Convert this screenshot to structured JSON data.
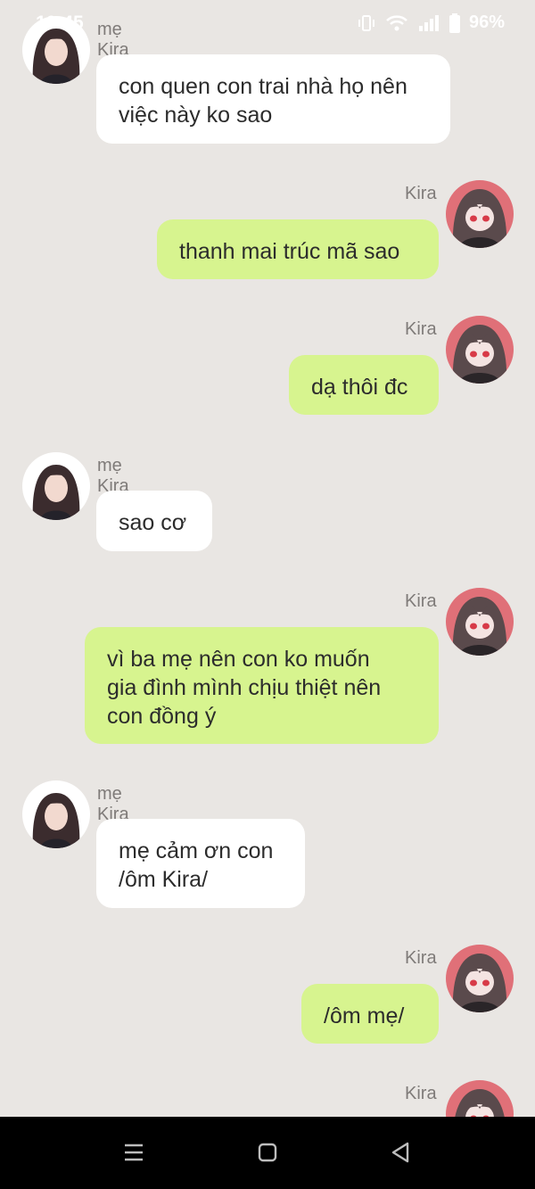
{
  "status": {
    "time": "10:45",
    "battery": "96%"
  },
  "messages": [
    {
      "side": "left",
      "sender": "mẹ Kira",
      "text": "con quen con trai nhà họ nên\nviệc này ko sao"
    },
    {
      "side": "right",
      "sender": "Kira",
      "text": "thanh mai trúc mã sao"
    },
    {
      "side": "right",
      "sender": "Kira",
      "text": "dạ thôi đc"
    },
    {
      "side": "left",
      "sender": "mẹ Kira",
      "text": "sao cơ"
    },
    {
      "side": "right",
      "sender": "Kira",
      "text": "vì ba mẹ nên con ko muốn\ngia đình mình chịu thiệt nên\ncon đồng ý"
    },
    {
      "side": "left",
      "sender": "mẹ Kira",
      "text": "mẹ cảm ơn con\n/ôm Kira/"
    },
    {
      "side": "right",
      "sender": "Kira",
      "text": "/ôm mẹ/"
    },
    {
      "side": "right",
      "sender": "Kira",
      "text": ""
    }
  ],
  "icons": {
    "vibrate": "vibrate-icon",
    "wifi": "wifi-icon",
    "signal": "signal-icon",
    "battery": "battery-icon",
    "recents": "recents-icon",
    "home": "home-icon",
    "back": "back-icon"
  },
  "colors": {
    "background": "#e9e6e3",
    "incoming_bubble": "#ffffff",
    "outgoing_bubble": "#d7f48f",
    "sender_name": "#7f7b79",
    "nav_bar": "#000000"
  }
}
